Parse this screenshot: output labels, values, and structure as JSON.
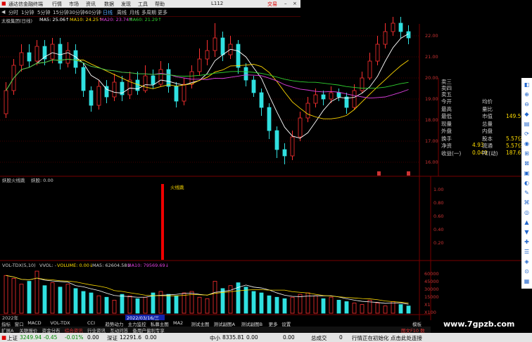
{
  "app": {
    "title": "通达信金融终端",
    "menus": [
      "行情",
      "市场",
      "资讯",
      "数据",
      "发现",
      "工具",
      "帮助"
    ],
    "trade": "交易",
    "user": "L112"
  },
  "toolbar": {
    "items": [
      "分时",
      "1分钟",
      "5分钟",
      "15分钟",
      "30分钟",
      "60分钟",
      "日线",
      "周线",
      "月线",
      "多周期",
      "更多"
    ],
    "selected": "日线"
  },
  "stock": {
    "name": "太极集团(日线)"
  },
  "ma": [
    {
      "label": "MA5: 25.06↑",
      "color": "#ffffff"
    },
    {
      "label": "MA10: 24.25↑",
      "color": "#ffd700"
    },
    {
      "label": "MA20: 23.74↑",
      "color": "#e040e0"
    },
    {
      "label": "MA60: 21.29↑",
      "color": "#30d030"
    }
  ],
  "price_axis": [
    "22.00",
    "21.00",
    "20.00",
    "19.00",
    "18.00",
    "17.00",
    "16.00"
  ],
  "panel2": {
    "title": "妖股火线跳",
    "value": "妖股: 0.00",
    "marker": "火线跳",
    "axis": [
      "1.00",
      "0.80",
      "0.60",
      "0.40",
      "0.20"
    ]
  },
  "panel3": {
    "title": "VOL-TDX(5,10)",
    "vvol": "VVOL: -",
    "volume": "VOLUME: 0.00↓",
    "ma5": "MA5: 62604.58↓",
    "ma10": "MA10: 79569.69↓",
    "date_tag": "2022/03/16/三",
    "axis": [
      "60000",
      "45000",
      "30000",
      "15000",
      "X1",
      "X100"
    ],
    "year": "2022年"
  },
  "bottom_tabs1": [
    "指标",
    "窗口",
    "MACD",
    "VOL-TDX",
    "CCI",
    "趋势动力",
    "主力监控",
    "私募主图",
    "MA2",
    "测试主图",
    "测试副图A",
    "测试副图B",
    "更多",
    "设置"
  ],
  "bottom_tabs1_right": "模板",
  "bottom_tabs2": [
    "扩展A",
    "关联报价",
    "资金分布",
    "综合资讯",
    "行业资讯",
    "互动问答",
    "备用户偏利专享"
  ],
  "bottom_tabs2_right": "图文F10 数",
  "quote": {
    "orders": [
      "卖三",
      "卖四",
      "卖五"
    ],
    "rows": [
      {
        "l": "今开",
        "lv": "",
        "r": "均价",
        "rv": ""
      },
      {
        "l": "最高",
        "lv": "",
        "r": "量比",
        "rv": ""
      },
      {
        "l": "最低",
        "lv": "",
        "r": "市值",
        "rv": "149.5亿"
      },
      {
        "l": "现量",
        "lv": "",
        "r": "总量",
        "rv": ""
      },
      {
        "l": "外盘",
        "lv": "",
        "r": "内盘",
        "rv": ""
      },
      {
        "l": "换手",
        "lv": "",
        "r": "股本",
        "rv": "5.57亿"
      },
      {
        "l": "净资",
        "lv": "4.93",
        "r": "流通",
        "rv": "5.57亿"
      },
      {
        "l": "收益(一)",
        "lv": "0.040",
        "r": "PE(动)",
        "rv": "187.6"
      }
    ]
  },
  "status": {
    "sh": {
      "name": "上证",
      "value": "3249.94",
      "chg": "-0.45",
      "pct": "-0.01%"
    },
    "sh2": "0.00",
    "sz": {
      "name": "深证",
      "value": "12291.6",
      "v2": "0.00"
    },
    "mid": {
      "name": "中小",
      "value": "8335.81",
      "v2": "0.00"
    },
    "extra": "0.00",
    "deal": "总成交",
    "deal_value": "0",
    "msg": "行情正在初始化 点击此处连接"
  },
  "watermark": "www.7gpzb.com",
  "chart_data": {
    "type": "candlestick",
    "title": "太极集团(日线)",
    "ylim": [
      15.5,
      22.5
    ],
    "candles": [
      [
        18.3,
        19.4,
        19.8,
        18.1
      ],
      [
        19.4,
        20.6,
        20.9,
        19.2
      ],
      [
        20.6,
        21.2,
        21.6,
        20.3
      ],
      [
        21.2,
        20.8,
        21.6,
        20.5
      ],
      [
        20.8,
        21.5,
        21.8,
        20.6
      ],
      [
        21.5,
        20.9,
        21.8,
        20.6
      ],
      [
        20.9,
        21.6,
        21.9,
        20.7
      ],
      [
        21.6,
        20.7,
        21.9,
        20.4
      ],
      [
        20.7,
        21.3,
        21.7,
        20.5
      ],
      [
        21.3,
        20.5,
        21.6,
        20.2
      ],
      [
        20.5,
        19.4,
        20.7,
        19.1
      ],
      [
        19.4,
        18.7,
        19.6,
        18.4
      ],
      [
        18.7,
        19.6,
        19.9,
        18.5
      ],
      [
        19.6,
        19.1,
        19.9,
        18.8
      ],
      [
        19.1,
        19.8,
        20.2,
        18.9
      ],
      [
        19.8,
        19.2,
        20.1,
        18.9
      ],
      [
        19.2,
        19.9,
        20.3,
        19.0
      ],
      [
        19.9,
        19.4,
        20.3,
        19.2
      ],
      [
        19.4,
        20.1,
        20.6,
        19.3
      ],
      [
        20.1,
        19.7,
        20.4,
        19.5
      ],
      [
        19.7,
        20.4,
        20.8,
        19.6
      ],
      [
        20.4,
        19.6,
        20.7,
        19.3
      ],
      [
        19.6,
        18.9,
        19.8,
        18.6
      ],
      [
        18.9,
        19.7,
        20.0,
        18.7
      ],
      [
        19.7,
        20.3,
        20.6,
        19.5
      ],
      [
        20.3,
        20.9,
        21.4,
        20.1
      ],
      [
        20.9,
        21.3,
        21.8,
        20.6
      ],
      [
        21.3,
        21.9,
        22.6,
        21.0
      ],
      [
        21.9,
        21.1,
        22.2,
        20.8
      ],
      [
        21.1,
        21.6,
        22.0,
        20.9
      ],
      [
        21.6,
        20.5,
        21.8,
        20.2
      ],
      [
        20.5,
        19.9,
        20.7,
        19.6
      ],
      [
        19.9,
        19.3,
        20.1,
        19.1
      ],
      [
        19.3,
        18.6,
        19.5,
        18.2
      ],
      [
        18.6,
        17.5,
        18.8,
        17.1
      ],
      [
        17.5,
        16.6,
        17.7,
        16.2
      ],
      [
        16.6,
        16.3,
        16.9,
        15.9
      ],
      [
        16.3,
        17.2,
        17.5,
        16.1
      ],
      [
        17.2,
        18.1,
        18.4,
        17.0
      ],
      [
        18.1,
        18.8,
        19.1,
        17.9
      ],
      [
        18.8,
        19.2,
        19.5,
        18.6
      ],
      [
        19.2,
        19.0,
        19.4,
        18.7
      ],
      [
        19.0,
        19.3,
        19.6,
        18.8
      ],
      [
        19.3,
        19.1,
        19.5,
        18.9
      ],
      [
        19.1,
        18.6,
        19.3,
        18.3
      ],
      [
        18.6,
        19.4,
        19.7,
        18.5
      ],
      [
        19.4,
        20.0,
        20.3,
        19.3
      ],
      [
        20.0,
        20.8,
        21.2,
        19.9
      ],
      [
        20.8,
        21.6,
        22.0,
        20.6
      ],
      [
        21.6,
        22.2,
        22.6,
        21.4
      ],
      [
        22.2,
        22.6,
        22.9,
        22.0
      ],
      [
        22.6,
        22.2,
        22.9,
        21.9
      ],
      [
        22.2,
        21.9,
        22.5,
        21.6
      ]
    ],
    "volumes": [
      52,
      48,
      40,
      44,
      58,
      38,
      42,
      36,
      40,
      34,
      30,
      28,
      24,
      22,
      18,
      26,
      24,
      20,
      22,
      28,
      30,
      26,
      24,
      28,
      30,
      22,
      20,
      44,
      34,
      38,
      42,
      36,
      30,
      28,
      24,
      22,
      20,
      22,
      26,
      28,
      24,
      20,
      22,
      18,
      16,
      14,
      12,
      18,
      14,
      10,
      16,
      12,
      10
    ]
  }
}
